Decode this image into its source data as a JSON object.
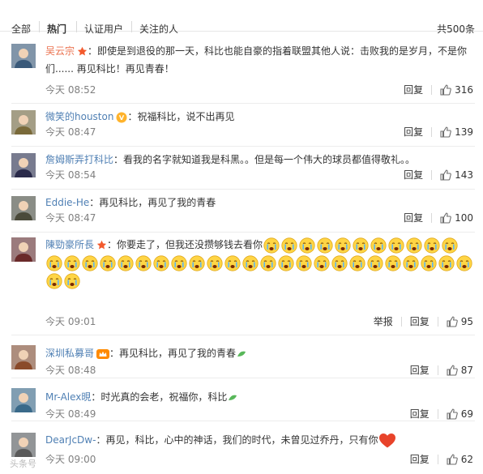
{
  "tabs": [
    "全部",
    "热门",
    "认证用户",
    "关注的人"
  ],
  "total_count": "共500条",
  "actions": {
    "reply": "回复",
    "report": "举报"
  },
  "colors": {
    "username": "#eb7350",
    "username_blue": "#5080b4",
    "time": "#808080",
    "like_icon": "#6e6e6e"
  },
  "comments": [
    {
      "username": "吴云宗",
      "badge": "star-icon",
      "text": "：即使是到退役的那一天，科比也能自豪的指着联盟其他人说：击败我的是岁月，不是你们...... 再见科比！再见青春！",
      "time": "今天 08:52",
      "likes": "316"
    },
    {
      "username": "微笑的houston",
      "badge": "vip-v-icon",
      "text": "：祝福科比，说不出再见",
      "time": "今天 08:47",
      "likes": "139"
    },
    {
      "username": "詹姆斯弄打科比",
      "badge": "",
      "text": "：看我的名字就知道我是科黑。。但是每一个伟大的球员都值得敬礼。。",
      "time": "今天 08:54",
      "likes": "143"
    },
    {
      "username": "Eddie-He",
      "badge": "",
      "text": "：再见科比，再见了我的青春",
      "time": "今天 08:47",
      "likes": "100"
    },
    {
      "username": "陳勁豪所長",
      "badge": "star-icon",
      "text": "：你要走了，但我还没攒够钱去看你",
      "time": "今天 09:01",
      "likes": "95",
      "crying_emoji_count": 37
    },
    {
      "username": "深圳私募哥",
      "badge": "crown-icon",
      "text": "：再见科比，再见了我的青春",
      "time": "今天 08:48",
      "likes": "87"
    },
    {
      "username": "Mr-Alex晛",
      "badge": "",
      "text": "：时光真的会老，祝福你，科比",
      "time": "今天 08:49",
      "likes": "69"
    },
    {
      "username": "DearJcDw-",
      "badge": "",
      "text": "：再见，科比，心中的神话，我们的时代，未曾见过乔丹，只有你",
      "time": "今天 09:00",
      "likes": "62"
    }
  ],
  "watermark": "头条号"
}
